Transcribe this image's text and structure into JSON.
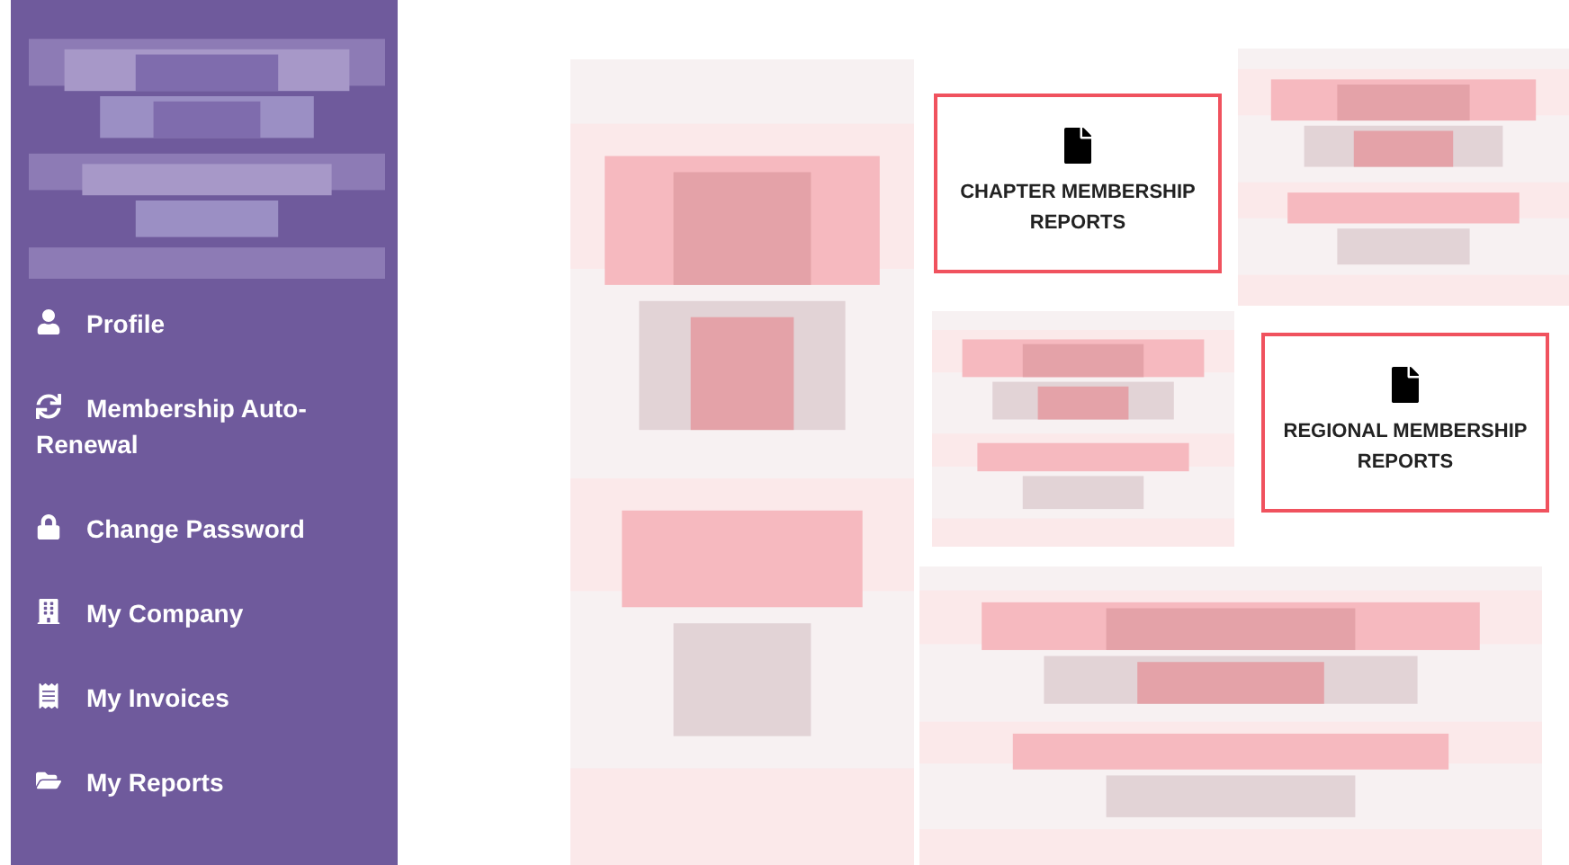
{
  "sidebar": {
    "items": [
      {
        "label": "Profile"
      },
      {
        "label": "Membership Auto-Renewal"
      },
      {
        "label": "Change Password"
      },
      {
        "label": "My Company"
      },
      {
        "label": "My Invoices"
      },
      {
        "label": "My Reports"
      }
    ]
  },
  "report_cards": [
    {
      "title": "CHAPTER MEMBERSHIP REPORTS"
    },
    {
      "title": "REGIONAL MEMBERSHIP REPORTS"
    }
  ]
}
